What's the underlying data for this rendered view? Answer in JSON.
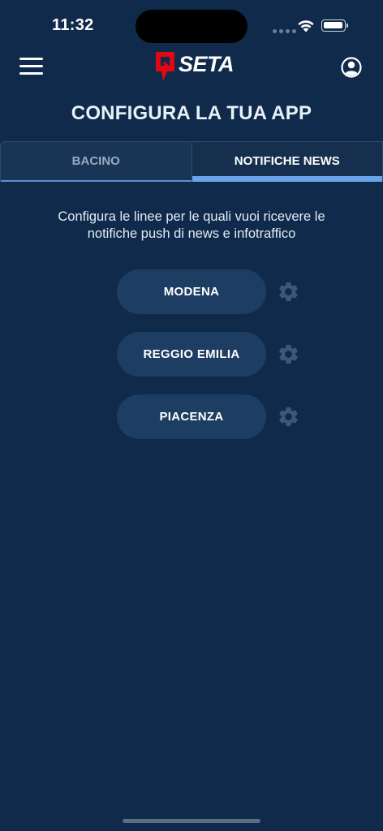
{
  "status_bar": {
    "time": "11:32",
    "icons": [
      "signal-dots-icon",
      "wifi-icon",
      "battery-icon"
    ]
  },
  "header": {
    "menu_icon": "hamburger-menu-icon",
    "logo_text": "SETA",
    "profile_icon": "user-profile-icon",
    "brand_red": "#e30613"
  },
  "page": {
    "title": "CONFIGURA LA TUA APP"
  },
  "tabs": [
    {
      "label": "BACINO",
      "active": false
    },
    {
      "label": "NOTIFICHE NEWS",
      "active": true
    }
  ],
  "description": "Configura le linee per le quali vuoi ricevere le notifiche push di news e infotraffico",
  "areas": [
    {
      "label": "MODENA",
      "settings_icon": "gear-icon"
    },
    {
      "label": "REGGIO EMILIA",
      "settings_icon": "gear-icon"
    },
    {
      "label": "PIACENZA",
      "settings_icon": "gear-icon"
    }
  ],
  "colors": {
    "background": "#0f2a4a",
    "button": "#1d3d62",
    "tab_indicator": "#6aa3e8",
    "gear": "#3a5878"
  }
}
